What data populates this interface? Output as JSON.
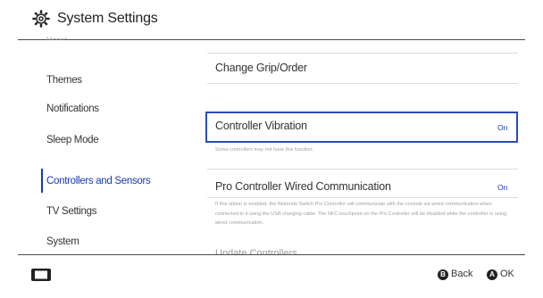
{
  "header": {
    "title": "System Settings",
    "icon": "gear-icon"
  },
  "sidebar": {
    "partial_top_item": "Users",
    "items": [
      {
        "label": "Themes"
      },
      {
        "label": "Notifications"
      },
      {
        "label": "Sleep Mode"
      },
      {
        "label": "Controllers and Sensors",
        "selected": true
      },
      {
        "label": "TV Settings"
      },
      {
        "label": "System"
      }
    ]
  },
  "main": {
    "rows": [
      {
        "label": "Change Grip/Order",
        "value": ""
      },
      {
        "label": "Controller Vibration",
        "value": "On",
        "focused": true,
        "note": "Some controllers may not have this function."
      },
      {
        "label": "Pro Controller Wired Communication",
        "value": "On",
        "note": "If this option is enabled, the Nintendo Switch Pro Controller will communicate with the console via wired communication when connected to it using the USB charging cable. The NFC touchpoint on the Pro Controller will be disabled while the controller is using wired communication."
      }
    ],
    "partial_bottom_row": "Update Controllers"
  },
  "footer": {
    "console_icon": "console-icon",
    "buttons": [
      {
        "glyph": "B",
        "label": "Back"
      },
      {
        "glyph": "A",
        "label": "OK"
      }
    ]
  },
  "colors": {
    "accent": "#1a3aa8",
    "focus_border": "#2a4db4",
    "text": "#333333",
    "note_text": "#a0a0a0"
  }
}
